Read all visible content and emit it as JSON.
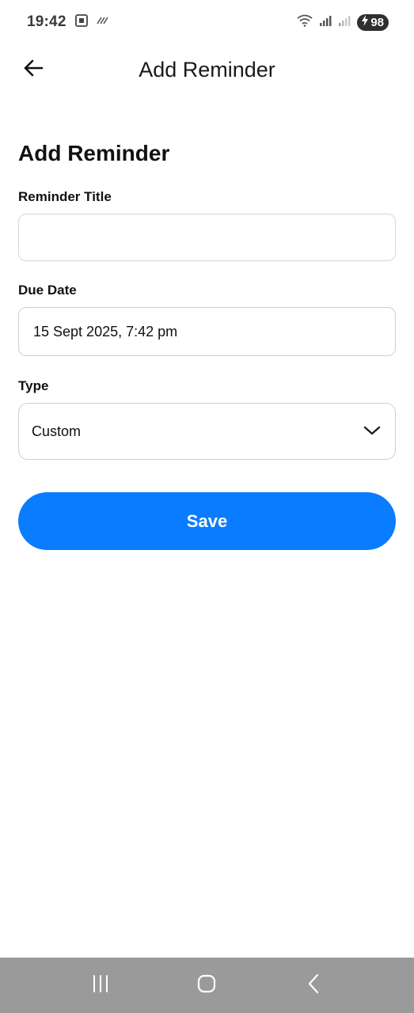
{
  "status_bar": {
    "time": "19:42",
    "battery": "98",
    "icons": [
      "screenshot-icon",
      "nfc-icon",
      "wifi-icon",
      "signal-icon",
      "signal-weak-icon",
      "battery-charging-icon"
    ]
  },
  "app_bar": {
    "title": "Add Reminder",
    "back_icon": "arrow-left-icon"
  },
  "form": {
    "heading": "Add Reminder",
    "title_label": "Reminder Title",
    "title_value": "",
    "title_placeholder": "",
    "due_date_label": "Due Date",
    "due_date_value": "15 Sept 2025, 7:42 pm",
    "type_label": "Type",
    "type_value": "Custom",
    "save_label": "Save"
  },
  "nav_bar": {
    "icons": [
      "recent-apps-icon",
      "home-icon",
      "back-icon"
    ]
  },
  "colors": {
    "accent": "#0a7cff",
    "nav_background": "#9a9a9a",
    "border": "#d6d6d6"
  }
}
